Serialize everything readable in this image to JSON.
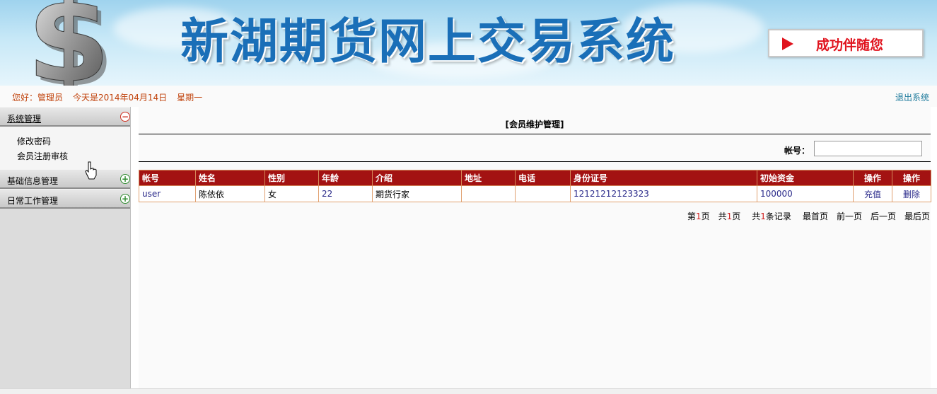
{
  "banner": {
    "title": "新湖期货网上交易系统",
    "badge_text": "成功伴随您",
    "logo_glyph": "$",
    "colors": {
      "title": "#1a6fb8",
      "badge": "#e0141e",
      "sky": "#9fd3ee"
    }
  },
  "greeting": {
    "hello": "您好：管理员",
    "date": "今天是2014年04月14日",
    "weekday": "星期一",
    "logout": "退出系统"
  },
  "sidebar": {
    "menus": [
      {
        "label": "系统管理",
        "expanded": true,
        "items": [
          "修改密码",
          "会员注册审核"
        ]
      },
      {
        "label": "基础信息管理",
        "expanded": false
      },
      {
        "label": "日常工作管理",
        "expanded": false
      }
    ],
    "toggle_minus": "−",
    "toggle_plus": "+"
  },
  "main": {
    "title": "[会员维护管理]",
    "search": {
      "label": "帐号：",
      "value": "",
      "placeholder": ""
    },
    "table": {
      "columns": [
        "帐号",
        "姓名",
        "性别",
        "年龄",
        "介绍",
        "地址",
        "电话",
        "身份证号",
        "初始资金",
        "操作",
        "操作"
      ],
      "rows": [
        {
          "account": "user",
          "name": "陈依依",
          "gender": "女",
          "age": "22",
          "intro": "期货行家",
          "address": "",
          "phone": "",
          "id_number": "12121212123323",
          "funds": "100000",
          "action1": "充值",
          "action2": "删除"
        }
      ],
      "header_color": "#a31212"
    },
    "pager": {
      "page_prefix": "第",
      "page_num": "1",
      "page_suffix": "页",
      "total_prefix": "共",
      "total_pages": "1",
      "total_suffix": "页",
      "records_prefix": "共",
      "records": "1",
      "records_suffix": "条记录",
      "first": "最首页",
      "prev": "前一页",
      "next": "后一页",
      "last": "最后页"
    }
  }
}
